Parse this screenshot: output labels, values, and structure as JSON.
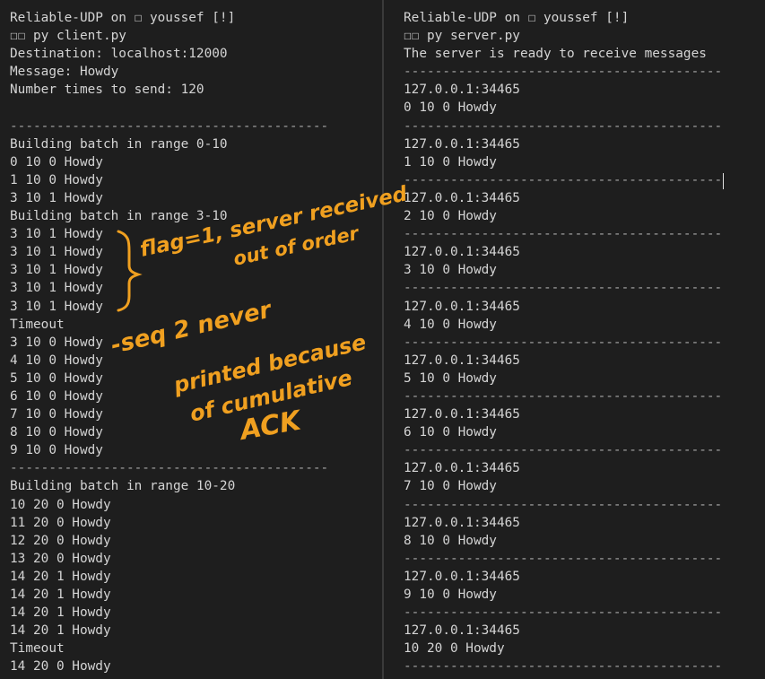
{
  "left": {
    "lines": [
      {
        "t": "Reliable-UDP on ☐ youssef [!]",
        "k": "text"
      },
      {
        "t": "☐☐ py client.py",
        "k": "text"
      },
      {
        "t": "Destination: localhost:12000",
        "k": "text"
      },
      {
        "t": "Message: Howdy",
        "k": "text"
      },
      {
        "t": "Number times to send: 120",
        "k": "text"
      },
      {
        "t": "",
        "k": "text"
      },
      {
        "t": "-----------------------------------------",
        "k": "sep"
      },
      {
        "t": "Building batch in range 0-10",
        "k": "text"
      },
      {
        "t": "0 10 0 Howdy",
        "k": "text"
      },
      {
        "t": "1 10 0 Howdy",
        "k": "text"
      },
      {
        "t": "3 10 1 Howdy",
        "k": "text"
      },
      {
        "t": "Building batch in range 3-10",
        "k": "text"
      },
      {
        "t": "3 10 1 Howdy",
        "k": "text"
      },
      {
        "t": "3 10 1 Howdy",
        "k": "text"
      },
      {
        "t": "3 10 1 Howdy",
        "k": "text"
      },
      {
        "t": "3 10 1 Howdy",
        "k": "text"
      },
      {
        "t": "3 10 1 Howdy",
        "k": "text"
      },
      {
        "t": "Timeout",
        "k": "text"
      },
      {
        "t": "3 10 0 Howdy",
        "k": "text"
      },
      {
        "t": "4 10 0 Howdy",
        "k": "text"
      },
      {
        "t": "5 10 0 Howdy",
        "k": "text"
      },
      {
        "t": "6 10 0 Howdy",
        "k": "text"
      },
      {
        "t": "7 10 0 Howdy",
        "k": "text"
      },
      {
        "t": "8 10 0 Howdy",
        "k": "text"
      },
      {
        "t": "9 10 0 Howdy",
        "k": "text"
      },
      {
        "t": "-----------------------------------------",
        "k": "sep"
      },
      {
        "t": "Building batch in range 10-20",
        "k": "text"
      },
      {
        "t": "10 20 0 Howdy",
        "k": "text"
      },
      {
        "t": "11 20 0 Howdy",
        "k": "text"
      },
      {
        "t": "12 20 0 Howdy",
        "k": "text"
      },
      {
        "t": "13 20 0 Howdy",
        "k": "text"
      },
      {
        "t": "14 20 1 Howdy",
        "k": "text"
      },
      {
        "t": "14 20 1 Howdy",
        "k": "text"
      },
      {
        "t": "14 20 1 Howdy",
        "k": "text"
      },
      {
        "t": "14 20 1 Howdy",
        "k": "text"
      },
      {
        "t": "Timeout",
        "k": "text"
      },
      {
        "t": "14 20 0 Howdy",
        "k": "text"
      }
    ]
  },
  "right": {
    "lines": [
      {
        "t": "Reliable-UDP on ☐ youssef [!]",
        "k": "text"
      },
      {
        "t": "☐☐ py server.py",
        "k": "text"
      },
      {
        "t": "The server is ready to receive messages",
        "k": "text"
      },
      {
        "t": "-----------------------------------------",
        "k": "sep"
      },
      {
        "t": "127.0.0.1:34465",
        "k": "text"
      },
      {
        "t": "0 10 0 Howdy",
        "k": "text"
      },
      {
        "t": "-----------------------------------------",
        "k": "sep"
      },
      {
        "t": "127.0.0.1:34465",
        "k": "text"
      },
      {
        "t": "1 10 0 Howdy",
        "k": "text"
      },
      {
        "t": "-----------------------------------------",
        "k": "sep"
      },
      {
        "t": "127.0.0.1:34465",
        "k": "text"
      },
      {
        "t": "2 10 0 Howdy",
        "k": "text"
      },
      {
        "t": "-----------------------------------------",
        "k": "sep"
      },
      {
        "t": "127.0.0.1:34465",
        "k": "text"
      },
      {
        "t": "3 10 0 Howdy",
        "k": "text"
      },
      {
        "t": "-----------------------------------------",
        "k": "sep"
      },
      {
        "t": "127.0.0.1:34465",
        "k": "text"
      },
      {
        "t": "4 10 0 Howdy",
        "k": "text"
      },
      {
        "t": "-----------------------------------------",
        "k": "sep"
      },
      {
        "t": "127.0.0.1:34465",
        "k": "text"
      },
      {
        "t": "5 10 0 Howdy",
        "k": "text"
      },
      {
        "t": "-----------------------------------------",
        "k": "sep"
      },
      {
        "t": "127.0.0.1:34465",
        "k": "text"
      },
      {
        "t": "6 10 0 Howdy",
        "k": "text"
      },
      {
        "t": "-----------------------------------------",
        "k": "sep"
      },
      {
        "t": "127.0.0.1:34465",
        "k": "text"
      },
      {
        "t": "7 10 0 Howdy",
        "k": "text"
      },
      {
        "t": "-----------------------------------------",
        "k": "sep"
      },
      {
        "t": "127.0.0.1:34465",
        "k": "text"
      },
      {
        "t": "8 10 0 Howdy",
        "k": "text"
      },
      {
        "t": "-----------------------------------------",
        "k": "sep"
      },
      {
        "t": "127.0.0.1:34465",
        "k": "text"
      },
      {
        "t": "9 10 0 Howdy",
        "k": "text"
      },
      {
        "t": "-----------------------------------------",
        "k": "sep"
      },
      {
        "t": "127.0.0.1:34465",
        "k": "text"
      },
      {
        "t": "10 20 0 Howdy",
        "k": "text"
      },
      {
        "t": "-----------------------------------------",
        "k": "sep"
      }
    ]
  },
  "annotations": {
    "flag_line1": "flag=1, server received",
    "flag_line2": "out of order",
    "seq_line1": "-seq 2 never",
    "seq_line2": "printed because",
    "seq_line3": "of cumulative",
    "seq_line4": "ACK",
    "ink_color": "#f0a020"
  },
  "colors": {
    "background": "#1e1e1e",
    "text": "#d4d4d4",
    "separator": "#a8a8a8"
  }
}
